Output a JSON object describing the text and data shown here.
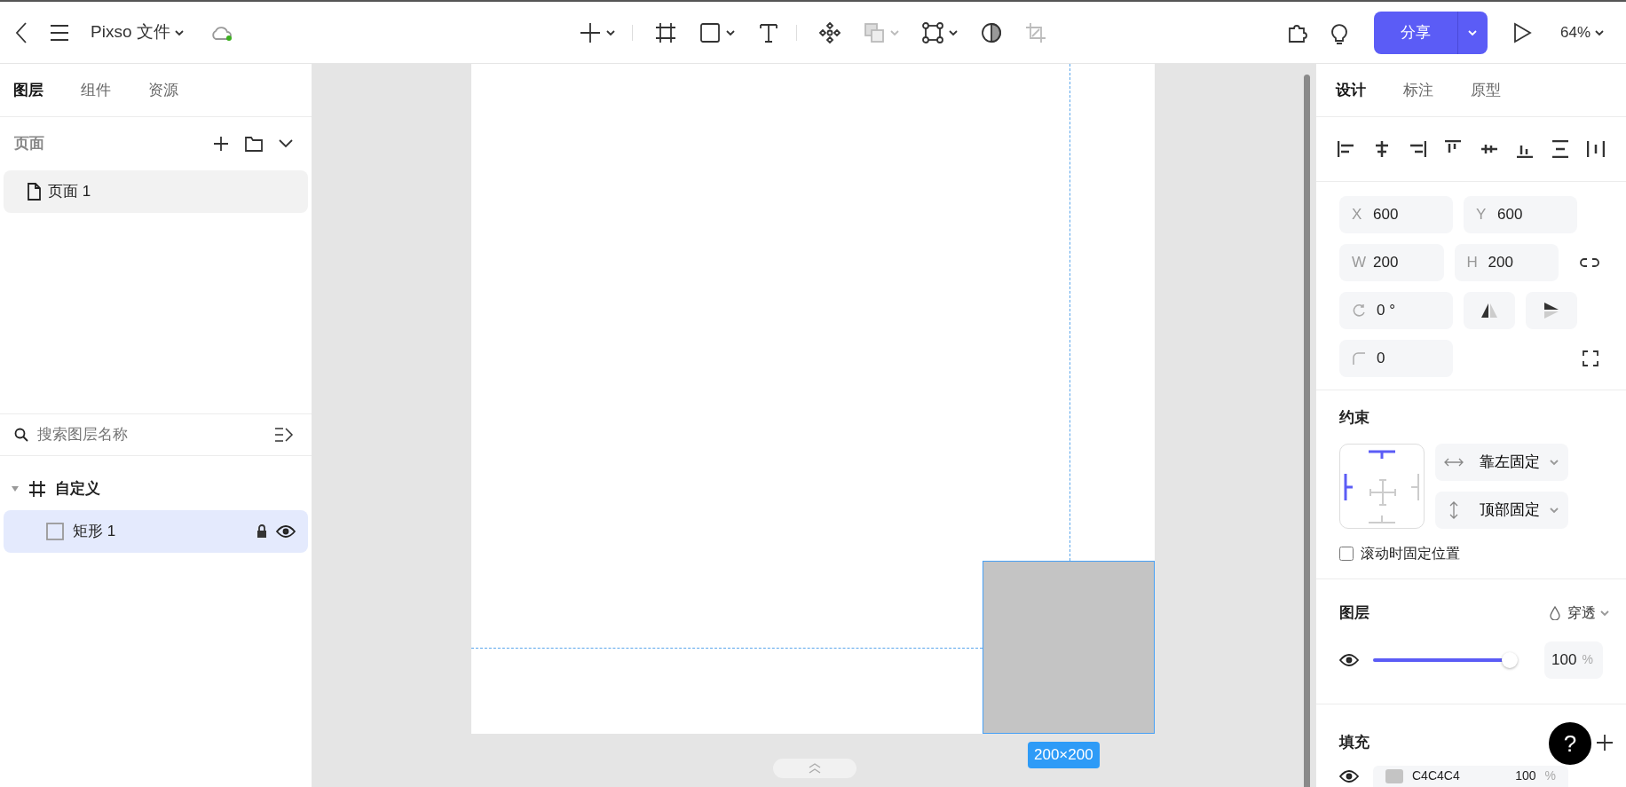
{
  "toolbar": {
    "file_name": "Pixso 文件",
    "synced": true,
    "tools": [
      {
        "kind": "add",
        "dropdown": true,
        "disabled": false,
        "separator_after": true
      },
      {
        "kind": "frame",
        "dropdown": false,
        "disabled": false,
        "separator_after": false
      },
      {
        "kind": "shape",
        "dropdown": true,
        "disabled": false,
        "separator_after": false
      },
      {
        "kind": "text",
        "dropdown": false,
        "disabled": false,
        "separator_after": true
      },
      {
        "kind": "component",
        "dropdown": false,
        "disabled": false,
        "separator_after": false
      },
      {
        "kind": "boolean",
        "dropdown": true,
        "disabled": true,
        "separator_after": false
      },
      {
        "kind": "vector",
        "dropdown": true,
        "disabled": false,
        "separator_after": false
      },
      {
        "kind": "mask",
        "dropdown": false,
        "disabled": false,
        "separator_after": false
      },
      {
        "kind": "crop",
        "dropdown": false,
        "disabled": true,
        "separator_after": false
      }
    ],
    "share_label": "分享",
    "zoom": "64%"
  },
  "left_panel": {
    "tabs": [
      {
        "label": "图层",
        "selected": true
      },
      {
        "label": "组件",
        "selected": false
      },
      {
        "label": "资源",
        "selected": false
      }
    ],
    "pages_title": "页面",
    "pages": [
      {
        "label": "页面 1",
        "selected": true
      }
    ],
    "search": {
      "placeholder": "搜索图层名称"
    },
    "layers": [
      {
        "kind": "frame",
        "label": "自定义",
        "expanded": true,
        "selected": false,
        "children": [
          {
            "kind": "rectangle",
            "label": "矩形 1",
            "selected": true,
            "locked": true,
            "visible": true
          }
        ]
      }
    ]
  },
  "canvas": {
    "selection_size": "200×200"
  },
  "help_label": "?",
  "right_panel": {
    "tabs": [
      {
        "label": "设计",
        "selected": true
      },
      {
        "label": "标注",
        "selected": false
      },
      {
        "label": "原型",
        "selected": false
      }
    ],
    "fields": [
      {
        "kind": "x",
        "label": "X",
        "value": "600"
      },
      {
        "kind": "y",
        "label": "Y",
        "value": "600"
      },
      {
        "kind": "w",
        "label": "W",
        "value": "200"
      },
      {
        "kind": "h",
        "label": "H",
        "value": "200"
      },
      {
        "kind": "rotation",
        "value": "0 °"
      },
      {
        "kind": "radius",
        "value": "0"
      }
    ],
    "constraints": {
      "title": "约束",
      "horizontal": "靠左固定",
      "vertical": "顶部固定",
      "fix_on_scroll": {
        "label": "滚动时固定位置",
        "checked": false
      }
    },
    "layer": {
      "title": "图层",
      "blend": "穿透",
      "visible": true,
      "opacity": {
        "level": 1.0,
        "value": "100",
        "unit": "%"
      }
    },
    "fill": {
      "title": "填充",
      "items": [
        {
          "color": "#c4c4c4",
          "hex": "C4C4C4",
          "opacity": "100",
          "unit": "%"
        }
      ]
    }
  }
}
